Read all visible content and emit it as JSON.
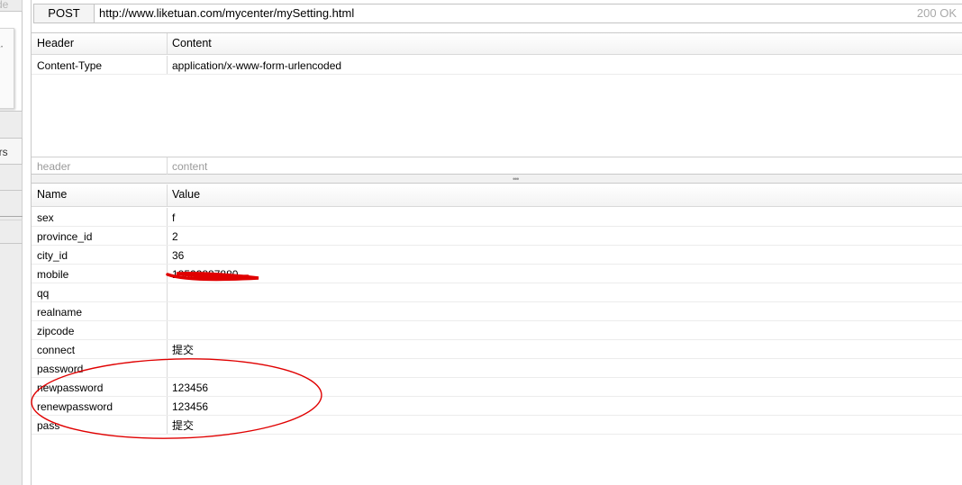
{
  "left_pane": {
    "faded_text": "de",
    "tab_label": "ers",
    "paper_text": "·•"
  },
  "request": {
    "method": "POST",
    "url": "http://www.liketuan.com/mycenter/mySetting.html",
    "status": "200 OK"
  },
  "headers": {
    "columns": [
      "Header",
      "Content"
    ],
    "rows": [
      {
        "name": "Content-Type",
        "value": "application/x-www-form-urlencoded"
      }
    ],
    "new_row_placeholders": [
      "header",
      "content"
    ]
  },
  "params": {
    "columns": [
      "Name",
      "Value"
    ],
    "rows": [
      {
        "name": "sex",
        "value": "f"
      },
      {
        "name": "province_id",
        "value": "2"
      },
      {
        "name": "city_id",
        "value": "36"
      },
      {
        "name": "mobile",
        "value": "18523887880"
      },
      {
        "name": "qq",
        "value": ""
      },
      {
        "name": "realname",
        "value": ""
      },
      {
        "name": "zipcode",
        "value": ""
      },
      {
        "name": "connect",
        "value": "提交"
      },
      {
        "name": "password",
        "value": ""
      },
      {
        "name": "newpassword",
        "value": "123456"
      },
      {
        "name": "renewpassword",
        "value": "123456"
      },
      {
        "name": "pass",
        "value": "提交"
      }
    ]
  },
  "annotation_color": "#e00000"
}
